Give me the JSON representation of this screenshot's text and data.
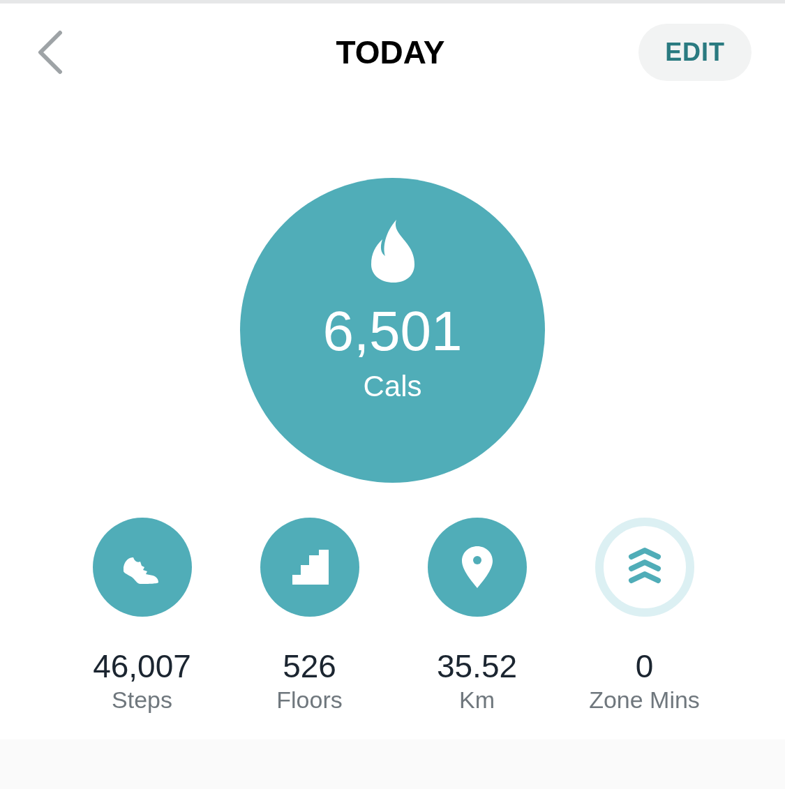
{
  "header": {
    "title": "TODAY",
    "action": "EDIT"
  },
  "main_stat": {
    "value": "6,501",
    "label": "Cals"
  },
  "stats": [
    {
      "kind": "steps",
      "value": "46,007",
      "label": "Steps",
      "goal_met": true
    },
    {
      "kind": "floors",
      "value": "526",
      "label": "Floors",
      "goal_met": true
    },
    {
      "kind": "distance",
      "value": "35.52",
      "label": "Km",
      "goal_met": true
    },
    {
      "kind": "zone",
      "value": "0",
      "label": "Zone Mins",
      "goal_met": false
    }
  ]
}
